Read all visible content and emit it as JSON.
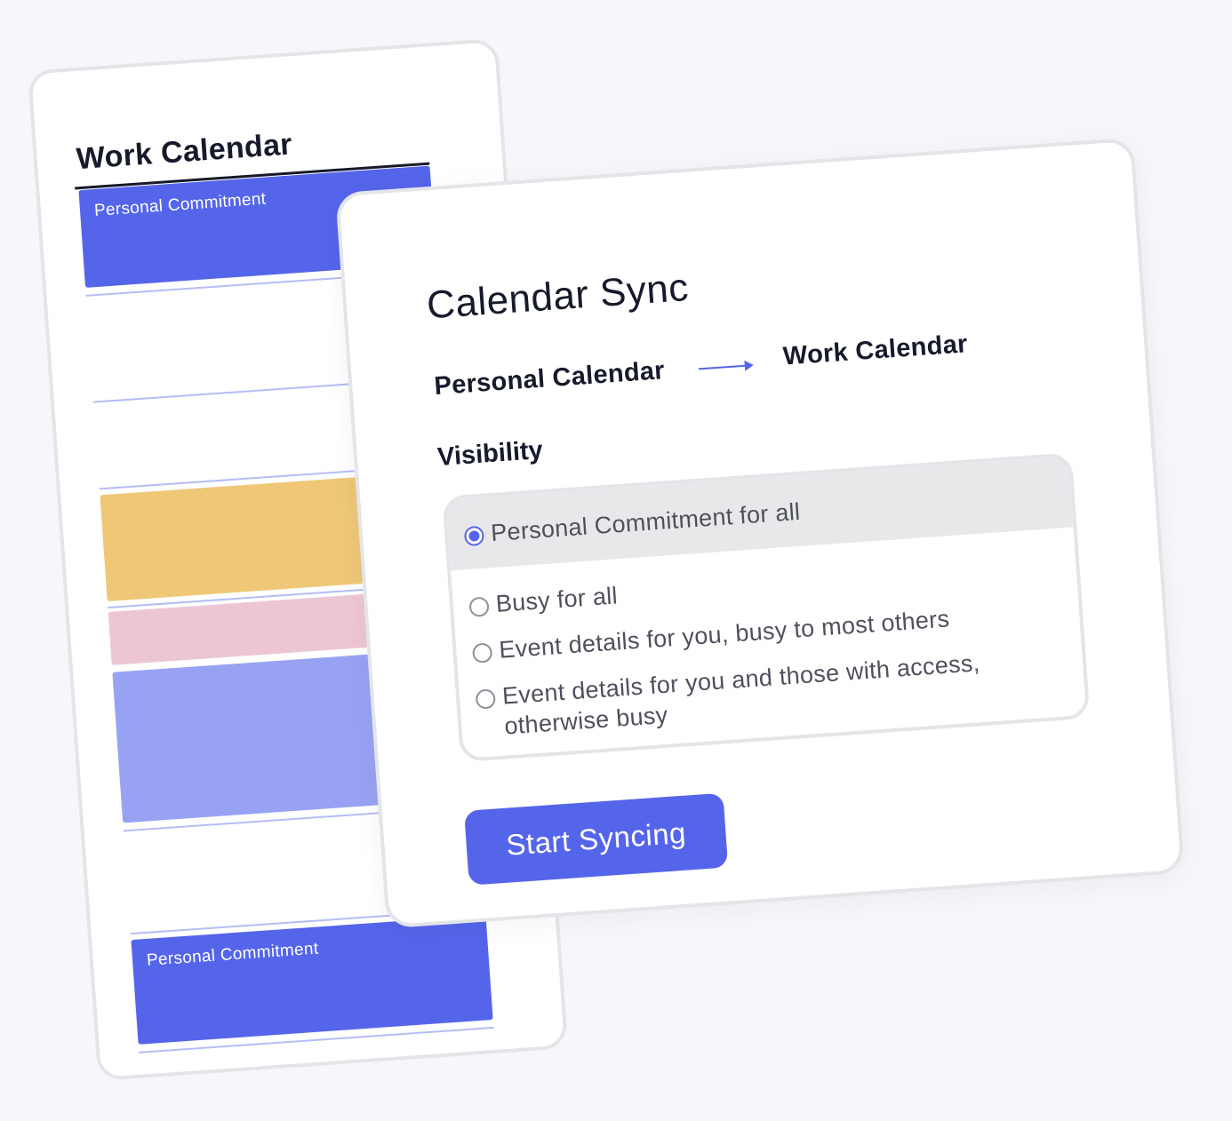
{
  "work_calendar": {
    "title": "Work Calendar",
    "events": {
      "top_label": "Personal Commitment",
      "bottom_label": "Personal Commitment"
    }
  },
  "sync_panel": {
    "title": "Calendar Sync",
    "source_calendar": "Personal Calendar",
    "target_calendar": "Work Calendar",
    "visibility_label": "Visibility",
    "options": [
      {
        "label": "Personal Commitment for all",
        "selected": true
      },
      {
        "label": "Busy for all",
        "selected": false
      },
      {
        "label": "Event details for you, busy to most others",
        "selected": false
      },
      {
        "label": "Event details for you and those with access, otherwise busy",
        "selected": false
      }
    ],
    "start_button_label": "Start Syncing"
  },
  "colors": {
    "accent": "#5565ea",
    "event_yellow": "#eec877",
    "event_pink": "#edc6d4",
    "event_lavender": "#97a3f2",
    "slot_line": "#b5bcf6",
    "selected_row_bg": "#e8e8ea"
  }
}
